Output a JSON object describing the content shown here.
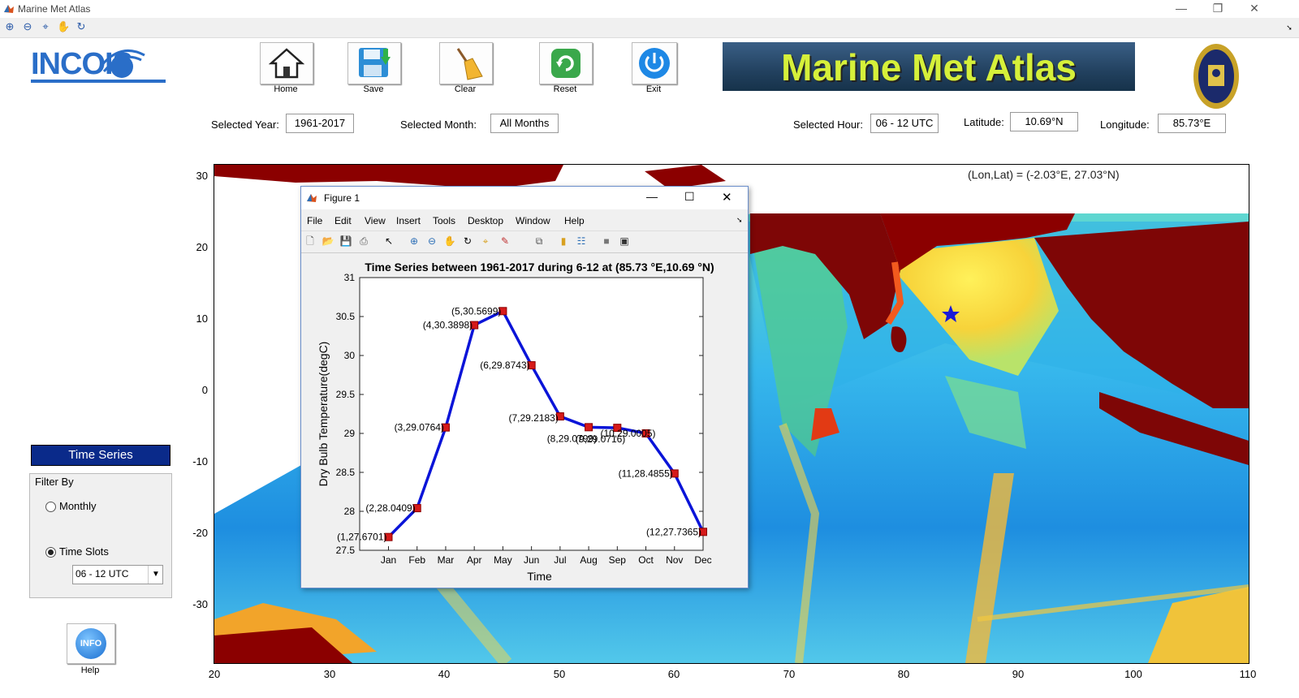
{
  "window": {
    "title": "Marine Met Atlas"
  },
  "toolbar": {
    "icons": [
      "zoom-in-icon",
      "zoom-out-icon",
      "data-cursor-icon",
      "pan-icon",
      "rotate-icon"
    ]
  },
  "buttons": {
    "home": "Home",
    "save": "Save",
    "clear": "Clear",
    "reset": "Reset",
    "exit": "Exit"
  },
  "logo": {
    "incois": "INCOIS"
  },
  "banner": {
    "title": "Marine Met Atlas"
  },
  "fields": {
    "year_label": "Selected Year:",
    "year_value": "1961-2017",
    "month_label": "Selected Month:",
    "month_value": "All Months",
    "hour_label": "Selected Hour:",
    "hour_value": "06 - 12 UTC",
    "lat_label": "Latitude:",
    "lat_value": "10.69°N",
    "lon_label": "Longitude:",
    "lon_value": "85.73°E"
  },
  "map": {
    "coord_readout": "(Lon,Lat) = (-2.03°E, 27.03°N)",
    "yticks": [
      "30",
      "20",
      "10",
      "0",
      "-10",
      "-20",
      "-30"
    ],
    "xticks": [
      "20",
      "30",
      "40",
      "50",
      "60",
      "70",
      "80",
      "90",
      "100",
      "110"
    ],
    "marker_lon": 85.73,
    "marker_lat": 10.69
  },
  "left_panel": {
    "time_series_button": "Time Series",
    "filter_title": "Filter By",
    "monthly_label": "Monthly",
    "timeslots_label": "Time Slots",
    "timeslot_value": "06 - 12 UTC",
    "info_button": "INFO",
    "help_label": "Help"
  },
  "figure": {
    "title": "Figure 1",
    "menus": [
      "File",
      "Edit",
      "View",
      "Insert",
      "Tools",
      "Desktop",
      "Window",
      "Help"
    ]
  },
  "chart_data": {
    "type": "line",
    "title": "Time Series between 1961-2017 during  6-12 at (85.73 °E,10.69 °N)",
    "xlabel": "Time",
    "ylabel": "Dry Bulb Temperature(degC)",
    "categories": [
      "Jan",
      "Feb",
      "Mar",
      "Apr",
      "May",
      "Jun",
      "Jul",
      "Aug",
      "Sep",
      "Oct",
      "Nov",
      "Dec"
    ],
    "x": [
      1,
      2,
      3,
      4,
      5,
      6,
      7,
      8,
      9,
      10,
      11,
      12
    ],
    "values": [
      27.6701,
      28.0409,
      29.0764,
      30.3898,
      30.5699,
      29.8743,
      29.2183,
      29.0799,
      29.0716,
      29.0005,
      28.4855,
      27.7365
    ],
    "data_labels": [
      "(1,27.6701)",
      "(2,28.0409)",
      "(3,29.0764)",
      "(4,30.3898)",
      "(5,30.5699)",
      "(6,29.8743)",
      "(7,29.2183)",
      "(8,29.0799)",
      "(9,29.0716)",
      "(10,29.0005)",
      "(11,28.4855)",
      "(12,27.7365)"
    ],
    "ylim": [
      27.5,
      31
    ],
    "yticks": [
      "27.5",
      "28",
      "28.5",
      "29",
      "29.5",
      "30",
      "30.5",
      "31"
    ],
    "line_color": "#0a14d8",
    "marker_color": "#d61a1a",
    "grid": false
  }
}
